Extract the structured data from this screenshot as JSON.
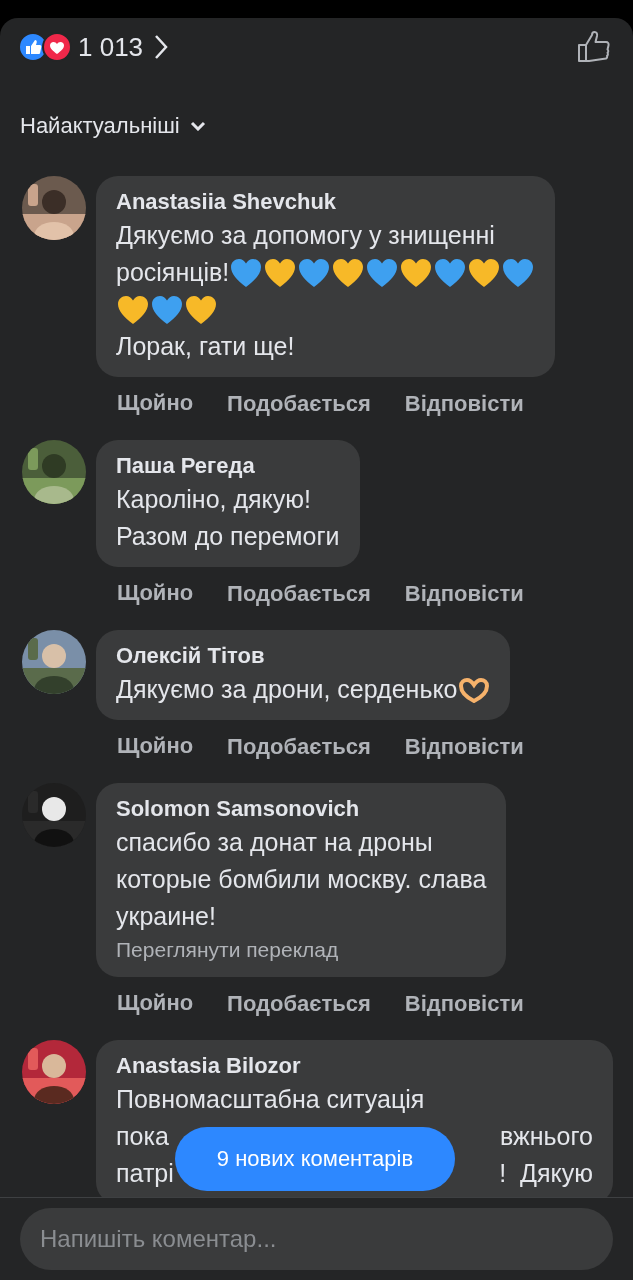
{
  "reactions": {
    "count": "1 013"
  },
  "sort": {
    "label": "Найактуальніші"
  },
  "comments": [
    {
      "author": "Anastasiia Shevchuk",
      "avatar": {
        "kind": "picture"
      },
      "lines": [
        [
          {
            "kind": "text",
            "text": "Дякуємо за допомогу у знищенні"
          }
        ],
        [
          {
            "kind": "text",
            "text": "росіянців!"
          },
          {
            "kind": "heart",
            "color": "#3ea0f0"
          },
          {
            "kind": "heart",
            "color": "#f7b928"
          },
          {
            "kind": "heart",
            "color": "#3ea0f0"
          },
          {
            "kind": "heart",
            "color": "#f7b928"
          },
          {
            "kind": "heart",
            "color": "#3ea0f0"
          },
          {
            "kind": "heart",
            "color": "#f7b928"
          },
          {
            "kind": "heart",
            "color": "#3ea0f0"
          },
          {
            "kind": "heart",
            "color": "#f7b928"
          },
          {
            "kind": "heart",
            "color": "#3ea0f0"
          }
        ],
        [
          {
            "kind": "heart",
            "color": "#f7b928"
          },
          {
            "kind": "heart",
            "color": "#3ea0f0"
          },
          {
            "kind": "heart",
            "color": "#f7b928"
          }
        ],
        [
          {
            "kind": "text",
            "text": "Лорак, гати ще!"
          }
        ]
      ],
      "actions": [
        "Щойно",
        "Подобається",
        "Відповісти"
      ]
    },
    {
      "author": "Паша Регеда",
      "avatar": {
        "kind": "picture"
      },
      "lines": [
        [
          {
            "kind": "text",
            "text": "Кароліно, дякую!"
          }
        ],
        [
          {
            "kind": "text",
            "text": "Разом до перемоги"
          }
        ]
      ],
      "actions": [
        "Щойно",
        "Подобається",
        "Відповісти"
      ]
    },
    {
      "author": "Олексій Тітов",
      "avatar": {
        "kind": "picture"
      },
      "lines": [
        [
          {
            "kind": "text",
            "text": "Дякуємо за дрони, серденько"
          },
          {
            "kind": "hands-heart"
          }
        ]
      ],
      "actions": [
        "Щойно",
        "Подобається",
        "Відповісти"
      ]
    },
    {
      "author": "Solomon Samsonovich",
      "avatar": {
        "kind": "picture"
      },
      "lines": [
        [
          {
            "kind": "text",
            "text": "спасибо за донат на дроны"
          }
        ],
        [
          {
            "kind": "text",
            "text": "которые бомбили москву. слава"
          }
        ],
        [
          {
            "kind": "text",
            "text": "украине!"
          }
        ]
      ],
      "translation": "Переглянути переклад",
      "actions": [
        "Щойно",
        "Подобається",
        "Відповісти"
      ]
    },
    {
      "author": "Anastasia Bilozor",
      "avatar": {
        "kind": "picture"
      },
      "lines": [
        [
          {
            "kind": "text",
            "text": "Повномасштабна ситуація"
          }
        ],
        [
          {
            "kind": "text",
            "text": "пока"
          },
          {
            "kind": "gap"
          },
          {
            "kind": "text",
            "text": "вжнього"
          }
        ],
        [
          {
            "kind": "text",
            "text": "патрі"
          },
          {
            "kind": "gap"
          },
          {
            "kind": "text",
            "text": "!  Дякую"
          }
        ]
      ]
    }
  ],
  "new_comments_button": {
    "label": "9 нових коментарів"
  },
  "composer": {
    "placeholder": "Напишіть коментар..."
  }
}
